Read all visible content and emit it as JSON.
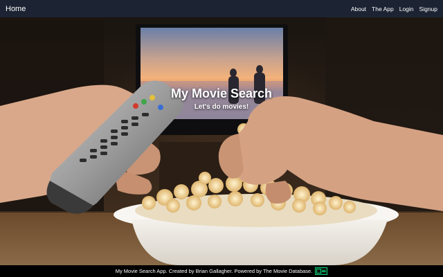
{
  "navbar": {
    "brand": "Home",
    "links": [
      "About",
      "The App",
      "Login",
      "Signup"
    ]
  },
  "hero": {
    "title": "My Movie Search",
    "subtitle": "Let's do movies!"
  },
  "footer": {
    "text": "My Movie Search App. Created by Brian Gallagher. Powered by The Movie Database.",
    "logo_icon": "tmdb-logo-icon"
  },
  "colors": {
    "navbar_bg": "#1c2333",
    "footer_bg": "#000000",
    "tmdb_green": "#01d277"
  }
}
